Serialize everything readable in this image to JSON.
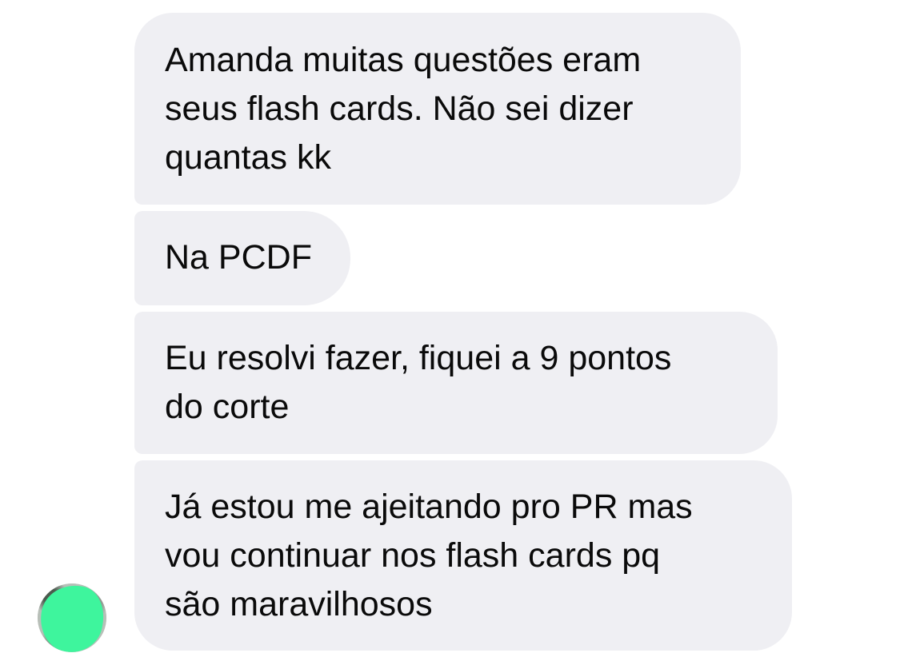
{
  "conversation": {
    "messages": [
      {
        "text": "Amanda muitas questões eram\nseus flash cards. Não sei dizer\nquantas kk"
      },
      {
        "text": "Na PCDF"
      },
      {
        "text": "Eu resolvi fazer, fiquei a 9 pontos\ndo corte"
      },
      {
        "text": "Já estou me ajeitando pro PR mas\nvou continuar nos flash cards pq\nsão maravilhosos"
      }
    ],
    "sender_avatar": {
      "redaction_color": "#3ef59d"
    }
  },
  "colors": {
    "bubble_background": "#efeff3",
    "text": "#0a0a0a",
    "page_background": "#ffffff"
  }
}
